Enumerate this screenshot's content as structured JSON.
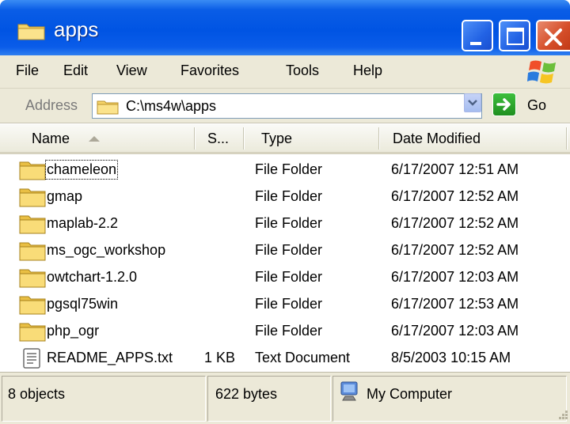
{
  "window": {
    "title": "apps",
    "folder_icon": "folder-icon",
    "minimize_icon": "minimize-icon",
    "maximize_icon": "maximize-icon",
    "close_icon": "close-icon"
  },
  "menu": {
    "items": [
      "File",
      "Edit",
      "View",
      "Favorites",
      "Tools",
      "Help"
    ]
  },
  "address": {
    "label": "Address",
    "value": "C:\\ms4w\\apps",
    "go_label": "Go"
  },
  "columns": [
    "Name",
    "S...",
    "Type",
    "Date Modified"
  ],
  "files": [
    {
      "name": "chameleon",
      "size": "",
      "type": "File Folder",
      "date": "6/17/2007 12:51 AM",
      "icon": "folder-icon"
    },
    {
      "name": "gmap",
      "size": "",
      "type": "File Folder",
      "date": "6/17/2007 12:52 AM",
      "icon": "folder-icon"
    },
    {
      "name": "maplab-2.2",
      "size": "",
      "type": "File Folder",
      "date": "6/17/2007 12:52 AM",
      "icon": "folder-icon"
    },
    {
      "name": "ms_ogc_workshop",
      "size": "",
      "type": "File Folder",
      "date": "6/17/2007 12:52 AM",
      "icon": "folder-icon"
    },
    {
      "name": "owtchart-1.2.0",
      "size": "",
      "type": "File Folder",
      "date": "6/17/2007 12:03 AM",
      "icon": "folder-icon"
    },
    {
      "name": "pgsql75win",
      "size": "",
      "type": "File Folder",
      "date": "6/17/2007 12:53 AM",
      "icon": "folder-icon"
    },
    {
      "name": "php_ogr",
      "size": "",
      "type": "File Folder",
      "date": "6/17/2007 12:03 AM",
      "icon": "folder-icon"
    },
    {
      "name": "README_APPS.txt",
      "size": "1 KB",
      "type": "Text Document",
      "date": "8/5/2003 10:15 AM",
      "icon": "text-document-icon"
    }
  ],
  "status": {
    "objects": "8 objects",
    "bytes": "622 bytes",
    "location": "My Computer"
  },
  "colors": {
    "titlebar_blue": "#0054e3",
    "chrome_beige": "#ece9d8",
    "folder_yellow": "#f2cf5b",
    "close_red": "#d6502b"
  }
}
